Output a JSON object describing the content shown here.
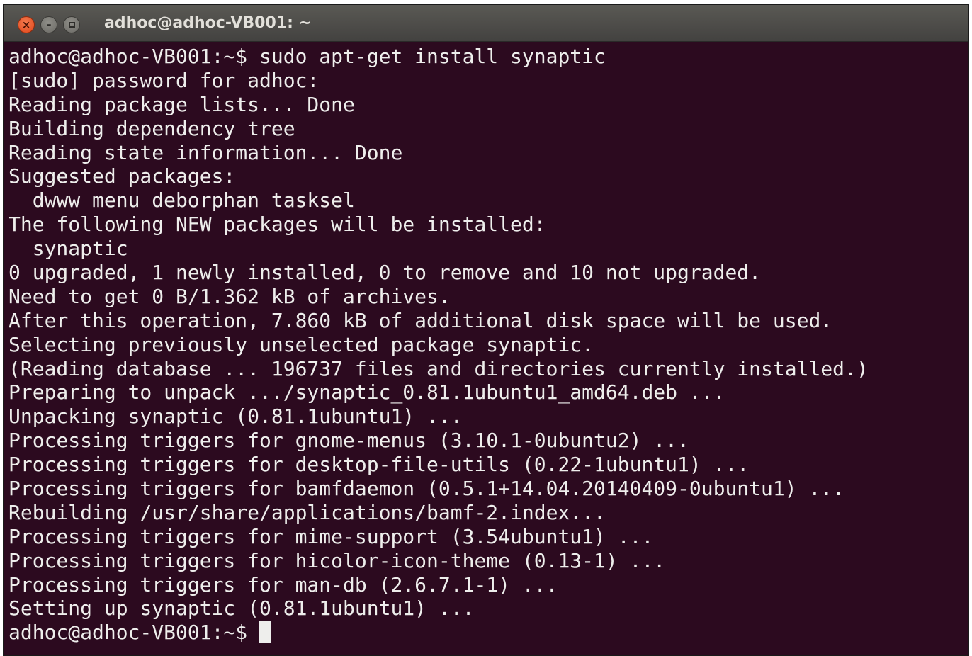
{
  "window": {
    "title": "adhoc@adhoc-VB001: ~",
    "close_glyph": "×",
    "minimize_glyph": "–"
  },
  "terminal": {
    "background": "#2c0a1f",
    "foreground": "#eeeeec",
    "lines": [
      "adhoc@adhoc-VB001:~$ sudo apt-get install synaptic",
      "[sudo] password for adhoc:",
      "Reading package lists... Done",
      "Building dependency tree",
      "Reading state information... Done",
      "Suggested packages:",
      "  dwww menu deborphan tasksel",
      "The following NEW packages will be installed:",
      "  synaptic",
      "0 upgraded, 1 newly installed, 0 to remove and 10 not upgraded.",
      "Need to get 0 B/1.362 kB of archives.",
      "After this operation, 7.860 kB of additional disk space will be used.",
      "Selecting previously unselected package synaptic.",
      "(Reading database ... 196737 files and directories currently installed.)",
      "Preparing to unpack .../synaptic_0.81.1ubuntu1_amd64.deb ...",
      "Unpacking synaptic (0.81.1ubuntu1) ...",
      "Processing triggers for gnome-menus (3.10.1-0ubuntu2) ...",
      "Processing triggers for desktop-file-utils (0.22-1ubuntu1) ...",
      "Processing triggers for bamfdaemon (0.5.1+14.04.20140409-0ubuntu1) ...",
      "Rebuilding /usr/share/applications/bamf-2.index...",
      "Processing triggers for mime-support (3.54ubuntu1) ...",
      "Processing triggers for hicolor-icon-theme (0.13-1) ...",
      "Processing triggers for man-db (2.6.7.1-1) ...",
      "Setting up synaptic (0.81.1ubuntu1) ..."
    ],
    "prompt": "adhoc@adhoc-VB001:~$ "
  }
}
